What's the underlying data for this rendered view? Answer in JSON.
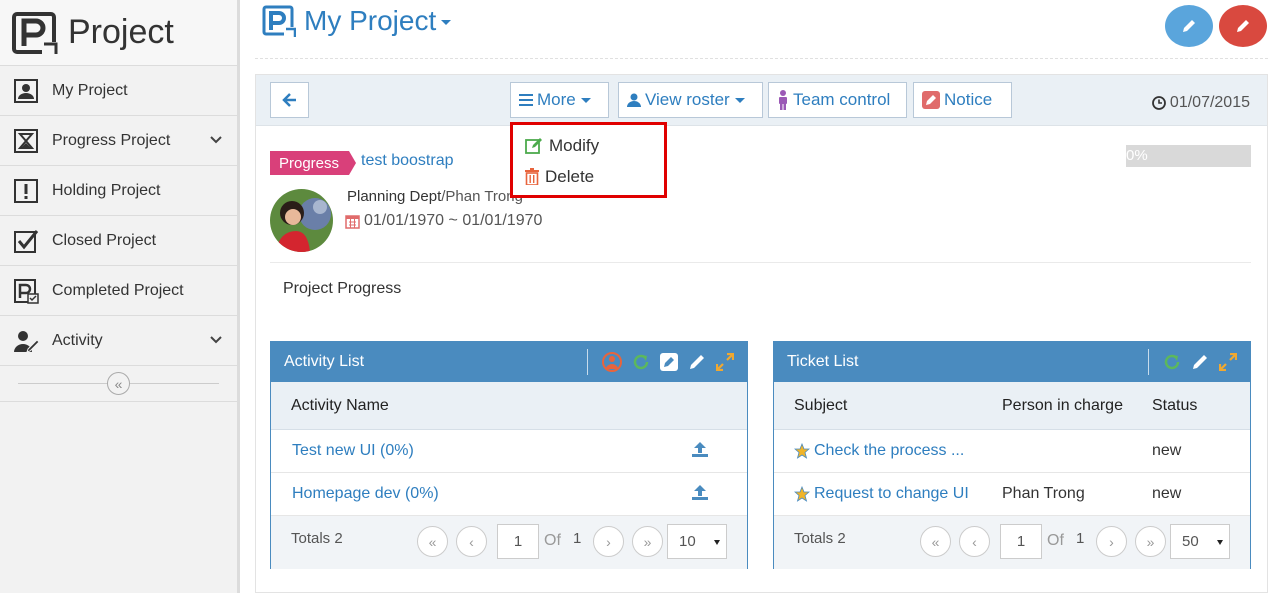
{
  "app": {
    "brand": "Project"
  },
  "sidebar": {
    "items": [
      {
        "label": "My Project",
        "icon": "user-icon"
      },
      {
        "label": "Progress Project",
        "icon": "hourglass-icon",
        "expandable": true
      },
      {
        "label": "Holding Project",
        "icon": "exclamation-icon"
      },
      {
        "label": "Closed Project",
        "icon": "checkbox-icon"
      },
      {
        "label": "Completed Project",
        "icon": "project-check-icon"
      },
      {
        "label": "Activity",
        "icon": "user-edit-icon",
        "expandable": true
      }
    ],
    "collapse_glyph": "«"
  },
  "header": {
    "title": "My Project"
  },
  "toolbar": {
    "more_label": "More",
    "view_roster_label": "View roster",
    "team_control_label": "Team control",
    "notice_label": "Notice",
    "date": "01/07/2015"
  },
  "more_menu": {
    "items": [
      {
        "label": "Modify"
      },
      {
        "label": "Delete"
      }
    ]
  },
  "project": {
    "status": "Progress",
    "name": "test boostrap",
    "progress_text": "0%",
    "progress": 0,
    "dept": "Planning Dept",
    "owner": "/Phan Trong",
    "date_range": "01/01/1970 ~ 01/01/1970",
    "section_title": "Project Progress"
  },
  "activity_list": {
    "title": "Activity List",
    "column": "Activity Name",
    "rows": [
      {
        "name": "Test new UI (0%)"
      },
      {
        "name": "Homepage dev (0%)"
      }
    ],
    "totals": "Totals 2",
    "page": "1",
    "of_label": "Of",
    "total_pages": "1",
    "page_size": "10"
  },
  "ticket_list": {
    "title": "Ticket List",
    "columns": {
      "subject": "Subject",
      "person": "Person in charge",
      "status": "Status"
    },
    "rows": [
      {
        "subject": "Check the process ...",
        "person": "",
        "status": "new"
      },
      {
        "subject": "Request to change UI",
        "person": "Phan Trong",
        "status": "new"
      }
    ],
    "totals": "Totals 2",
    "page": "1",
    "of_label": "Of",
    "total_pages": "1",
    "page_size": "50"
  },
  "colors": {
    "accent": "#2e7ebf",
    "widget_header": "#4a8bbf",
    "status_tag": "#d9407a",
    "highlight_box": "#e00000",
    "edit_round_button": "#5aa5dc",
    "delete_round_button": "#d9493f"
  }
}
